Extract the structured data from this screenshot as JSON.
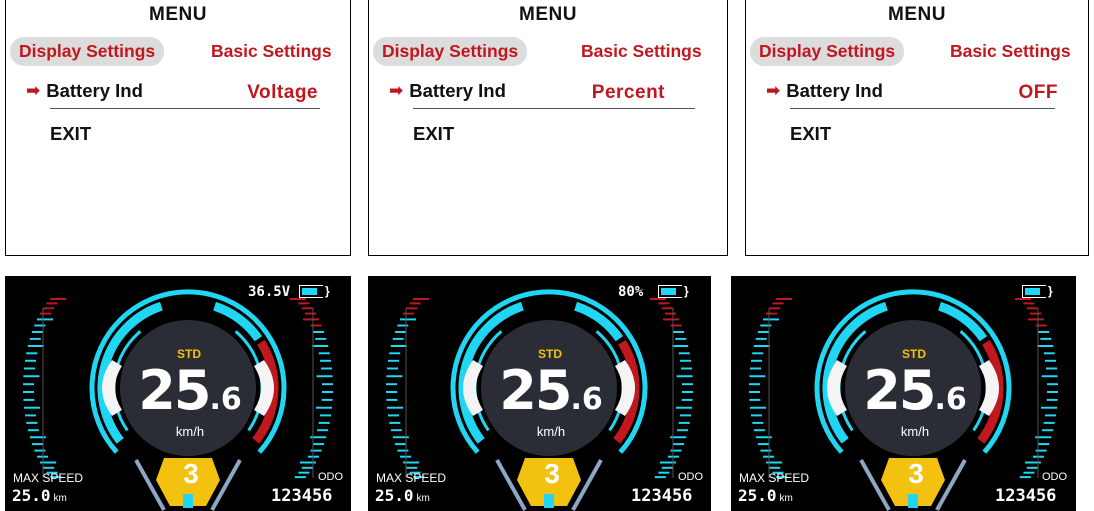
{
  "menu_panels": [
    {
      "title": "MENU",
      "tab_active": "Display Settings",
      "tab_other": "Basic Settings",
      "item_label": "Battery Ind",
      "item_value": "Voltage",
      "exit_label": "EXIT"
    },
    {
      "title": "MENU",
      "tab_active": "Display Settings",
      "tab_other": "Basic Settings",
      "item_label": "Battery Ind",
      "item_value": "Percent",
      "exit_label": "EXIT"
    },
    {
      "title": "MENU",
      "tab_active": "Display Settings",
      "tab_other": "Basic Settings",
      "item_label": "Battery Ind",
      "item_value": "OFF",
      "exit_label": "EXIT"
    }
  ],
  "dashboards": [
    {
      "battery_text": "36.5V",
      "battery_level": 0.8,
      "mode": "STD",
      "speed_int": "25",
      "speed_dec": ".6",
      "unit": "km/h",
      "max_speed_label": "MAX SPEED",
      "max_speed_value": "25.0",
      "max_speed_unit": "km",
      "odo_label": "ODO",
      "odo_value": "123456",
      "gear": "3"
    },
    {
      "battery_text": "80%",
      "battery_level": 0.8,
      "mode": "STD",
      "speed_int": "25",
      "speed_dec": ".6",
      "unit": "km/h",
      "max_speed_label": "MAX SPEED",
      "max_speed_value": "25.0",
      "max_speed_unit": "km",
      "odo_label": "ODO",
      "odo_value": "123456",
      "gear": "3"
    },
    {
      "battery_text": "",
      "battery_level": 0.8,
      "mode": "STD",
      "speed_int": "25",
      "speed_dec": ".6",
      "unit": "km/h",
      "max_speed_label": "MAX SPEED",
      "max_speed_value": "25.0",
      "max_speed_unit": "km",
      "odo_label": "ODO",
      "odo_value": "123456",
      "gear": "3"
    }
  ],
  "colors": {
    "accent_red": "#c0181e",
    "tab_bg": "#dcdcdc",
    "gauge_cyan": "#20d6f2",
    "gear_yellow": "#f3c10f"
  }
}
